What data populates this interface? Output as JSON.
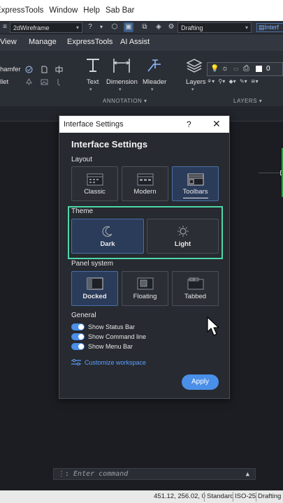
{
  "menubar": {
    "items": [
      "ExpressTools",
      "Window",
      "Help",
      "Sab Bar"
    ]
  },
  "qat": {
    "visual_style": "2dWireframe",
    "workspace": "Drafting",
    "interface_label": "Interf"
  },
  "ribbon_tabs": [
    "View",
    "Manage",
    "ExpressTools",
    "AI Assist"
  ],
  "ribbon": {
    "left_labels": [
      "hamfer",
      "llet"
    ],
    "buttons": {
      "text": "Text",
      "dimension": "Dimension",
      "mleader": "Mleader",
      "layers": "Layers"
    },
    "layer_value": "0",
    "sections": {
      "annotation": "ANNOTATION",
      "layers": "LAYERS"
    }
  },
  "command": {
    "placeholder": "Enter command",
    "prompt_glyph": "⋮:"
  },
  "status": {
    "coords": "451.12, 256.02, 0",
    "standard": "Standard",
    "iso": "ISO-25",
    "drafting": "Drafting"
  },
  "dialog": {
    "window_title": "Interface Settings",
    "help_glyph": "?",
    "close_glyph": "✕",
    "heading": "Interface Settings",
    "layout": {
      "label": "Layout",
      "options": [
        "Classic",
        "Modern",
        "Toolbars"
      ],
      "selected": "Toolbars"
    },
    "theme": {
      "label": "Theme",
      "options": [
        "Dark",
        "Light"
      ],
      "selected": "Dark"
    },
    "panel": {
      "label": "Panel system",
      "options": [
        "Docked",
        "Floating",
        "Tabbed"
      ],
      "selected": "Docked"
    },
    "general": {
      "label": "General",
      "toggles": [
        {
          "label": "Show Status Bar",
          "on": true
        },
        {
          "label": "Show Command line",
          "on": true
        },
        {
          "label": "Show Menu Bar",
          "on": true
        }
      ]
    },
    "customize_link": "Customize workspace",
    "apply": "Apply"
  },
  "colors": {
    "accent": "#4a8fe8",
    "highlight": "#4fd6a8",
    "dialog_bg": "#272a30",
    "canvas_bg": "#1b1d22"
  }
}
